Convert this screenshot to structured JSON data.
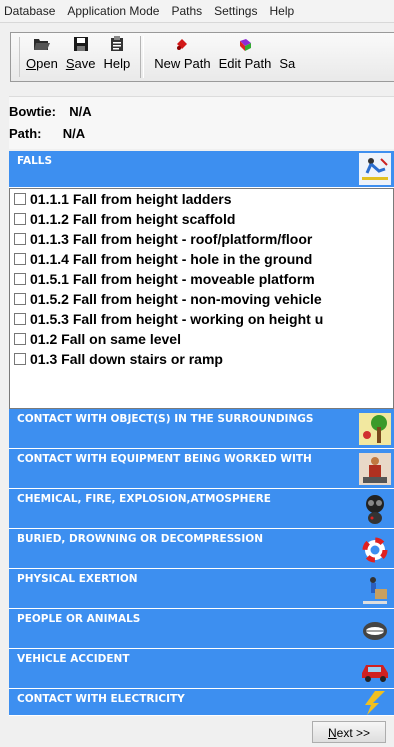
{
  "menu": [
    "Database",
    "Application Mode",
    "Paths",
    "Settings",
    "Help"
  ],
  "toolbar": {
    "open": {
      "key": "O",
      "rest": "pen"
    },
    "save": {
      "key": "S",
      "rest": "ave"
    },
    "help": {
      "key": "",
      "rest": "Help"
    },
    "new_path": "New Path",
    "edit_path": "Edit Path",
    "truncated": "Sa"
  },
  "info": {
    "bowtie_label": "Bowtie:",
    "bowtie_value": "N/A",
    "path_label": "Path:",
    "path_value": "N/A"
  },
  "selected_category": "FALLS",
  "items": [
    "01.1.1 Fall from height ladders",
    "01.1.2 Fall from height scaffold",
    "01.1.3 Fall from height - roof/platform/floor",
    "01.1.4 Fall from height - hole in the ground",
    "01.5.1 Fall from height - moveable platform",
    "01.5.2 Fall from height - non-moving vehicle",
    "01.5.3 Fall from height - working on height u",
    "01.2 Fall on same level",
    "01.3 Fall down stairs or ramp"
  ],
  "categories": [
    "CONTACT WITH OBJECT(S) IN THE SURROUNDINGS",
    "CONTACT WITH EQUIPMENT BEING WORKED WITH",
    "CHEMICAL, FIRE, EXPLOSION,ATMOSPHERE",
    "BURIED, DROWNING OR DECOMPRESSION",
    "PHYSICAL EXERTION",
    "PEOPLE OR ANIMALS",
    "VEHICLE ACCIDENT",
    "CONTACT WITH ELECTRICITY"
  ],
  "next_button": {
    "key": "N",
    "rest": "ext >>"
  },
  "colors": {
    "category_blue": "#3d8ff0"
  }
}
